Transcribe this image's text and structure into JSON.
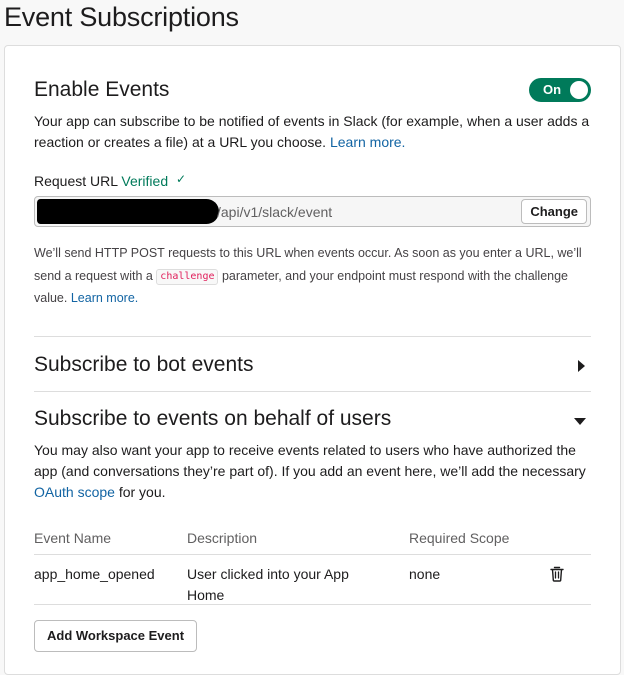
{
  "page": {
    "title": "Event Subscriptions"
  },
  "enable_events": {
    "title": "Enable Events",
    "toggle_label": "On",
    "toggle_state": "on",
    "description": "Your app can subscribe to be notified of events in Slack (for example, when a user adds a reaction or creates a file) at a URL you choose. ",
    "learn_more": "Learn more."
  },
  "request_url": {
    "label": "Request URL",
    "status": "Verified",
    "status_icon": "✓",
    "url_visible": "/api/v1/slack/event",
    "change_label": "Change",
    "help_part1": "We’ll send HTTP POST requests to this URL when events occur. As soon as you enter a URL, we’ll send a request with a ",
    "help_code": "challenge",
    "help_part2": " parameter, and your endpoint must respond with the challenge value. ",
    "help_link": "Learn more."
  },
  "bot_events": {
    "title": "Subscribe to bot events",
    "icon": "triangle-right-icon"
  },
  "user_events": {
    "title": "Subscribe to events on behalf of users",
    "icon": "triangle-down-icon",
    "description_part1": "You may also want your app to receive events related to users who have authorized the app (and conversations they’re part of). If you add an event here, we’ll add the necessary ",
    "description_link": "OAuth scope",
    "description_part2": " for you.",
    "table": {
      "headers": {
        "name": "Event Name",
        "description": "Description",
        "scope": "Required Scope"
      },
      "rows": [
        {
          "name": "app_home_opened",
          "description": "User clicked into your App Home",
          "scope": "none",
          "delete_icon": "trash-icon"
        }
      ]
    },
    "add_button": "Add Workspace Event"
  },
  "colors": {
    "accent_green": "#007a5a",
    "link_blue": "#1264a3",
    "code_red": "#e01e5a"
  }
}
